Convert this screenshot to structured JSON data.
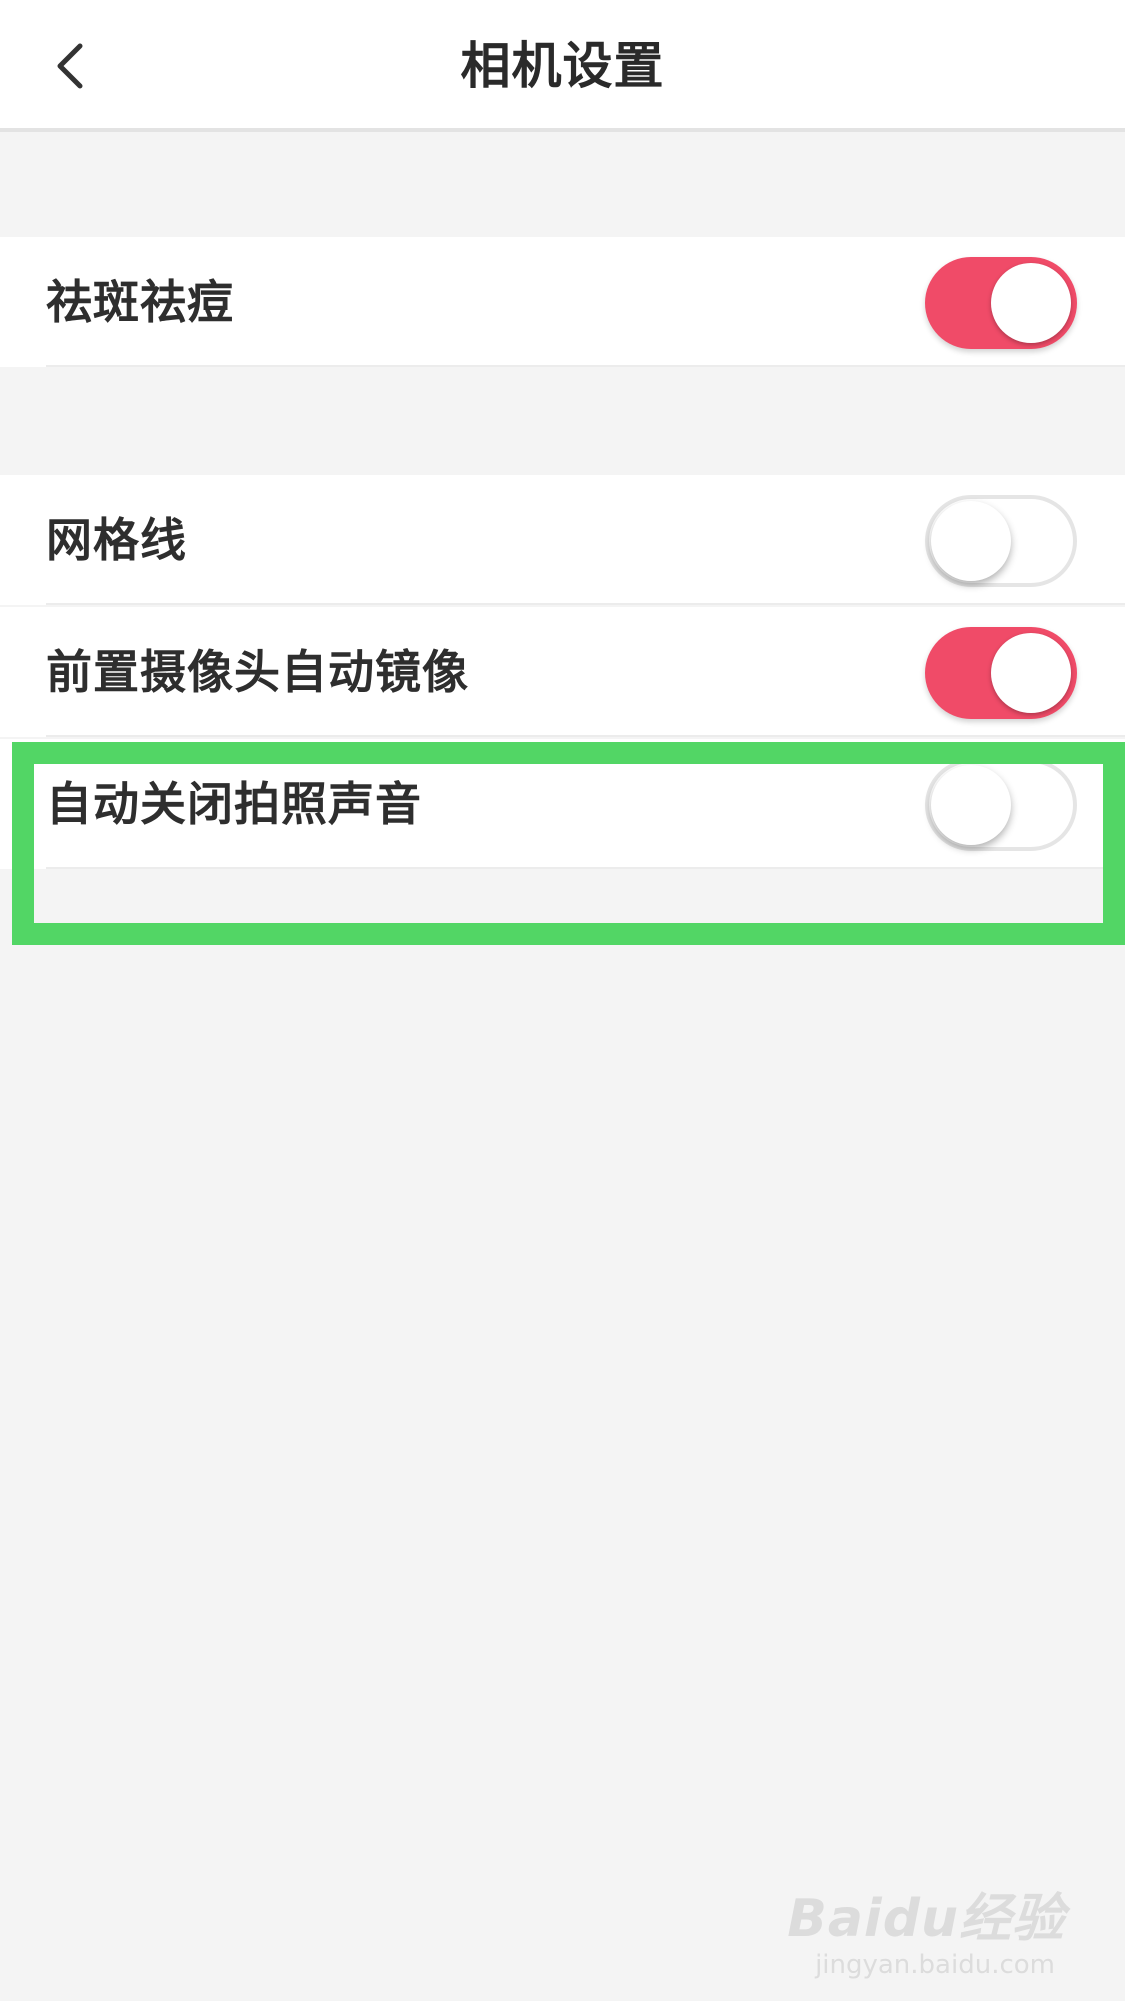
{
  "header": {
    "title": "相机设置",
    "back_icon": "chevron-left-icon"
  },
  "colors": {
    "toggle_on": "#f04b68",
    "toggle_off_border": "#e5e5e5",
    "highlight": "#52d665",
    "background": "#f4f4f4"
  },
  "settings": {
    "beauty": {
      "label": "祛斑祛痘",
      "enabled": true
    },
    "grid": {
      "label": "网格线",
      "enabled": false
    },
    "mirror": {
      "label": "前置摄像头自动镜像",
      "enabled": true
    },
    "shutter_sound": {
      "label": "自动关闭拍照声音",
      "enabled": false
    }
  },
  "watermark": {
    "logo": "Baidu经验",
    "url": "jingyan.baidu.com"
  }
}
